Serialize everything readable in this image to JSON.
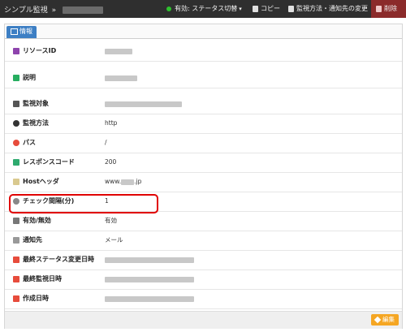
{
  "topbar": {
    "breadcrumb_root": "シンプル監視",
    "breadcrumb_sep": "»",
    "status_toggle": "有効: ステータス切替",
    "status_caret": "▾",
    "copy": "コピー",
    "method_change": "監視方法・通知先の変更",
    "delete": "削除"
  },
  "tab": {
    "label": "情報"
  },
  "rows": [
    {
      "label": "リソースID",
      "value": "",
      "icon": "id-card-icon",
      "color": "#8e44ad"
    },
    {
      "label": "説明",
      "value": "",
      "icon": "note-icon",
      "color": "#27ae60"
    },
    {
      "label": "監視対象",
      "value": "",
      "icon": "monitor-icon",
      "color": "#555555"
    },
    {
      "label": "監視方法",
      "value": "http",
      "icon": "globe-icon",
      "color": "#333333"
    },
    {
      "label": "パス",
      "value": "/",
      "icon": "pin-icon",
      "color": "#e74c3c"
    },
    {
      "label": "レスポンスコード",
      "value": "200",
      "icon": "arrow-icon",
      "color": "#2eaa6e"
    },
    {
      "label": "Hostヘッダ",
      "value": "www.",
      "value_suffix": ".jp",
      "icon": "tag-icon",
      "color": "#d9c98f"
    },
    {
      "label": "チェック間隔(分)",
      "value": "1",
      "icon": "clock-icon",
      "color": "#888888"
    },
    {
      "label": "有効/無効",
      "value": "有効",
      "icon": "power-icon",
      "color": "#777777"
    },
    {
      "label": "通知先",
      "value": "メール",
      "icon": "speaker-icon",
      "color": "#999999"
    },
    {
      "label": "最終ステータス変更日時",
      "value": "",
      "icon": "calendar-icon",
      "color": "#e74c3c"
    },
    {
      "label": "最終監視日時",
      "value": "",
      "icon": "calendar-icon",
      "color": "#e74c3c"
    },
    {
      "label": "作成日時",
      "value": "",
      "icon": "calendar-icon",
      "color": "#e74c3c"
    }
  ],
  "footer": {
    "edit": "編集"
  }
}
